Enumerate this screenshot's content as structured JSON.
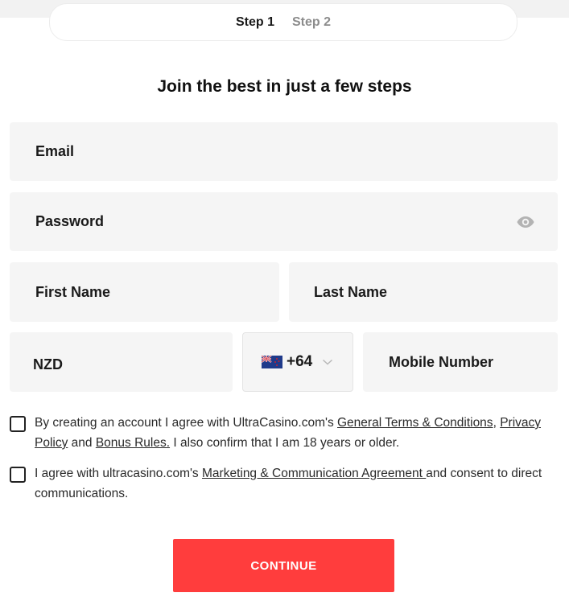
{
  "steps": {
    "step1": "Step 1",
    "step2": "Step 2"
  },
  "title": "Join the best in just a few steps",
  "fields": {
    "email": "Email",
    "password": "Password",
    "first_name": "First Name",
    "last_name": "Last Name",
    "currency": "NZD",
    "country_code": "+64",
    "mobile": "Mobile Number"
  },
  "icons": {
    "password_toggle": "eye-icon",
    "country_flag": "nz-flag-icon",
    "dropdown": "chevron-down-icon"
  },
  "consent1": {
    "part1": "By creating an account I agree with UltraCasino.com's ",
    "link_terms": "General Terms & Conditions",
    "part2": ", ",
    "link_privacy": "Privacy Policy",
    "part3": " and ",
    "link_bonus": "Bonus Rules.",
    "part4": " I also confirm that I am 18 years or older."
  },
  "consent2": {
    "part1": "I agree with ultracasino.com's ",
    "link_marketing": "Marketing & Communication Agreement ",
    "part2": "and consent to direct communications."
  },
  "continue_label": "CONTINUE",
  "colors": {
    "accent": "#ff3d3d",
    "field_bg": "#f5f5f5"
  }
}
